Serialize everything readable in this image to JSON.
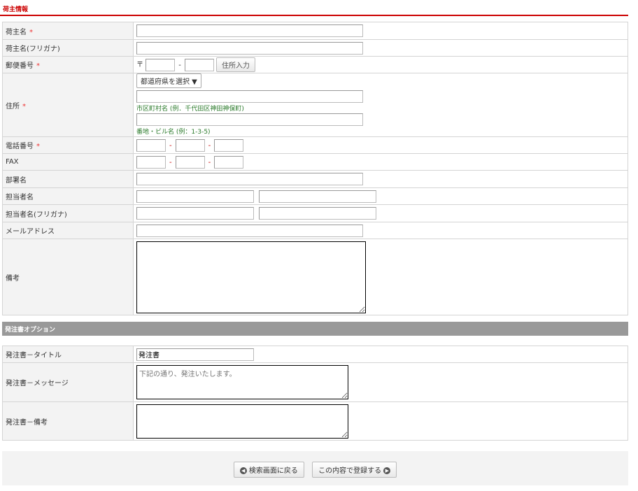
{
  "section1": {
    "title": "荷主情報"
  },
  "required_mark": "*",
  "fields": {
    "shipper_name": "荷主名",
    "shipper_kana": "荷主名(フリガナ)",
    "postal": "郵便番号",
    "postal_mark": "〒",
    "address_lookup": "住所入力",
    "address": "住所",
    "prefecture": "都道府県を選択 ▼",
    "city_hint": "市区町村名 (例．千代田区神田神保町)",
    "street_hint": "番地・ビル名 (例：1-3-5)",
    "phone": "電話番号",
    "fax": "FAX",
    "dash": "-",
    "department": "部署名",
    "contact": "担当者名",
    "contact_kana": "担当者名(フリガナ)",
    "email": "メールアドレス",
    "notes": "備考"
  },
  "section2": {
    "title": "発注書オプション",
    "po_title_label": "発注書－タイトル",
    "po_title_value": "発注書",
    "po_message_label": "発注書－メッセージ",
    "po_message_placeholder": "下記の通り、発注いたします。",
    "po_notes_label": "発注書－備考"
  },
  "footer": {
    "back": "検索画面に戻る",
    "submit": "この内容で登録する"
  }
}
